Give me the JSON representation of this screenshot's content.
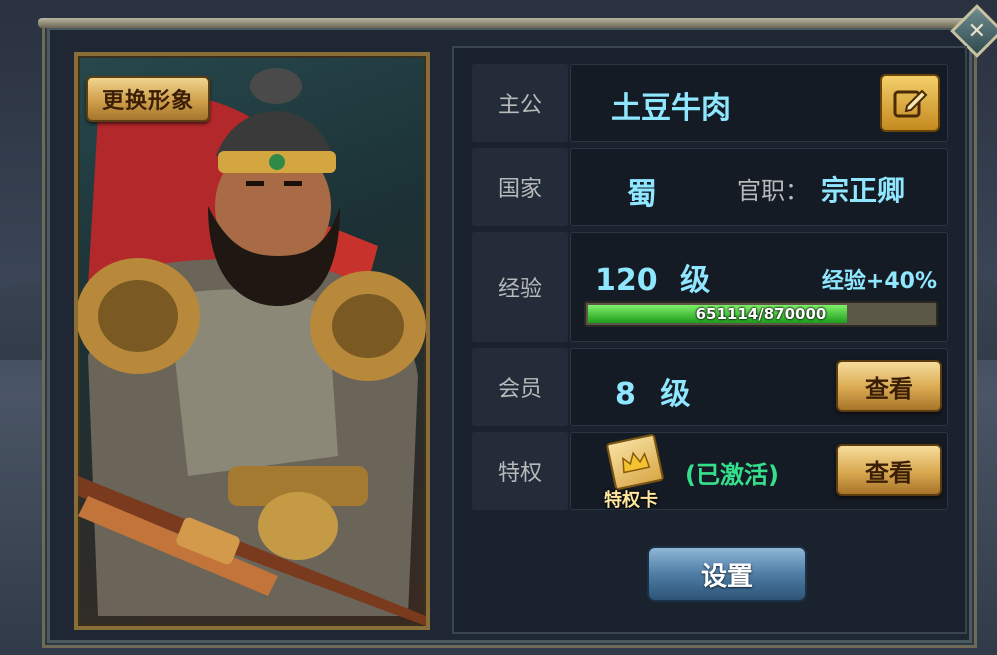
{
  "portrait": {
    "change_look_label": "更换形象"
  },
  "lord": {
    "label": "主公",
    "name": "土豆牛肉",
    "edit_icon": "edit-icon"
  },
  "country": {
    "label": "国家",
    "value": "蜀",
    "title_label": "官职：",
    "title_value": "宗正卿"
  },
  "experience": {
    "label": "经验",
    "level": "120",
    "level_unit": "级",
    "bonus": "经验+40%",
    "progress_text": "651114/870000",
    "current": 651114,
    "max": 870000
  },
  "membership": {
    "label": "会员",
    "level": "8",
    "level_unit": "级",
    "view_label": "查看"
  },
  "privilege": {
    "label": "特权",
    "card_label": "特权卡",
    "status": "(已激活)",
    "view_label": "查看"
  },
  "settings_label": "设置",
  "colors": {
    "cyan_text": "#8fe7ff",
    "green_status": "#35e08c",
    "gold_button": "#d9a84f",
    "exp_fill": "#1e9d1d"
  }
}
